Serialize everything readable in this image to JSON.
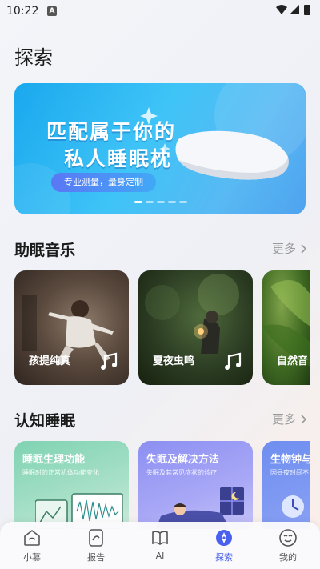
{
  "status": {
    "time": "10:22",
    "indicator": "A"
  },
  "page": {
    "title": "探索"
  },
  "banner": {
    "title_line1": "匹配属于你的",
    "title_line2": "私人睡眠枕",
    "pill": "专业测量，量身定制",
    "page_count": 5,
    "active_page": 1
  },
  "music": {
    "title": "助眠音乐",
    "more": "更多",
    "cards": [
      {
        "name": "孩提纯真"
      },
      {
        "name": "夏夜虫鸣"
      },
      {
        "name": "自然音"
      }
    ]
  },
  "knowledge": {
    "title": "认知睡眠",
    "more": "更多",
    "cards": [
      {
        "title": "睡眠生理功能",
        "subtitle": "睡眠时的正常机体功能变化"
      },
      {
        "title": "失眠及解决方法",
        "subtitle": "失眠及其常见症状的诊疗"
      },
      {
        "title": "生物钟与",
        "subtitle": "因昼夜时间不"
      }
    ]
  },
  "nav": {
    "items": [
      {
        "label": "小慕",
        "icon": "home-icon"
      },
      {
        "label": "报告",
        "icon": "report-icon"
      },
      {
        "label": "AI",
        "icon": "book-icon"
      },
      {
        "label": "探索",
        "icon": "compass-icon",
        "active": true
      },
      {
        "label": "我的",
        "icon": "face-icon"
      }
    ]
  },
  "colors": {
    "accent": "#4a61f0",
    "banner": "#3fc4f7"
  }
}
